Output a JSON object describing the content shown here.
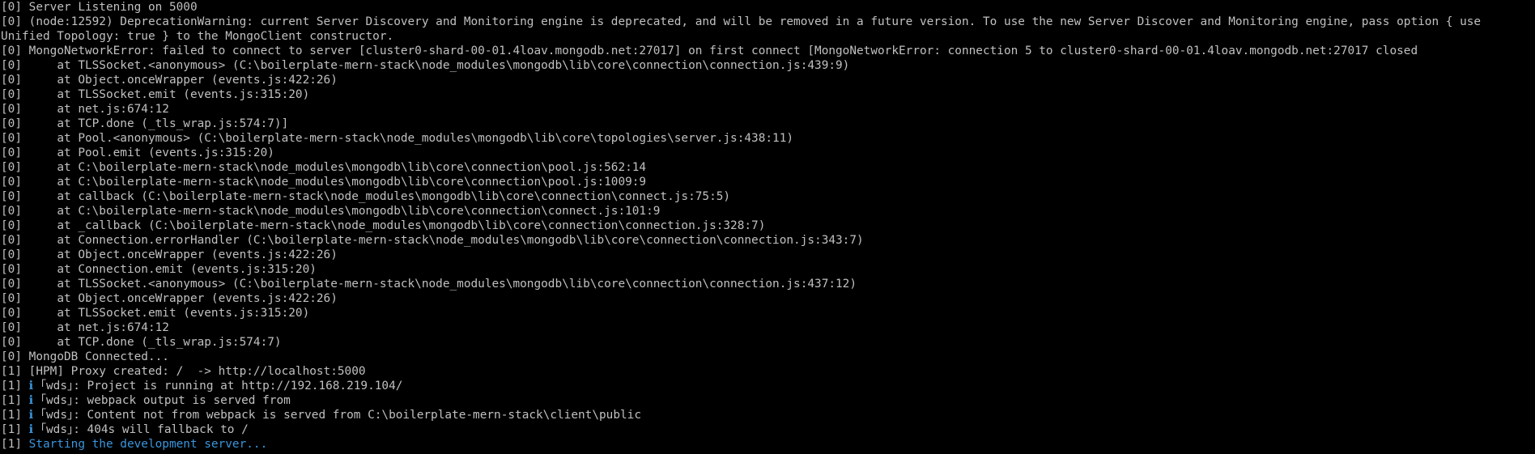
{
  "terminal": {
    "colors": {
      "background": "#000000",
      "foreground": "#c0c0c0",
      "accent": "#3a96dd"
    },
    "lines": [
      {
        "prefix": "[0]",
        "text": "Server Listening on 5000"
      },
      {
        "prefix": "[0]",
        "text": "(node:12592) DeprecationWarning: current Server Discovery and Monitoring engine is deprecated, and will be removed in a future version. To use the new Server Discover and Monitoring engine, pass option { use"
      },
      {
        "prefix": "",
        "text": "Unified Topology: true } to the MongoClient constructor."
      },
      {
        "prefix": "[0]",
        "text": "MongoNetworkError: failed to connect to server [cluster0-shard-00-01.4loav.mongodb.net:27017] on first connect [MongoNetworkError: connection 5 to cluster0-shard-00-01.4loav.mongodb.net:27017 closed"
      },
      {
        "prefix": "[0]",
        "text": "    at TLSSocket.<anonymous> (C:\\boilerplate-mern-stack\\node_modules\\mongodb\\lib\\core\\connection\\connection.js:439:9)"
      },
      {
        "prefix": "[0]",
        "text": "    at Object.onceWrapper (events.js:422:26)"
      },
      {
        "prefix": "[0]",
        "text": "    at TLSSocket.emit (events.js:315:20)"
      },
      {
        "prefix": "[0]",
        "text": "    at net.js:674:12"
      },
      {
        "prefix": "[0]",
        "text": "    at TCP.done (_tls_wrap.js:574:7)]"
      },
      {
        "prefix": "[0]",
        "text": "    at Pool.<anonymous> (C:\\boilerplate-mern-stack\\node_modules\\mongodb\\lib\\core\\topologies\\server.js:438:11)"
      },
      {
        "prefix": "[0]",
        "text": "    at Pool.emit (events.js:315:20)"
      },
      {
        "prefix": "[0]",
        "text": "    at C:\\boilerplate-mern-stack\\node_modules\\mongodb\\lib\\core\\connection\\pool.js:562:14"
      },
      {
        "prefix": "[0]",
        "text": "    at C:\\boilerplate-mern-stack\\node_modules\\mongodb\\lib\\core\\connection\\pool.js:1009:9"
      },
      {
        "prefix": "[0]",
        "text": "    at callback (C:\\boilerplate-mern-stack\\node_modules\\mongodb\\lib\\core\\connection\\connect.js:75:5)"
      },
      {
        "prefix": "[0]",
        "text": "    at C:\\boilerplate-mern-stack\\node_modules\\mongodb\\lib\\core\\connection\\connect.js:101:9"
      },
      {
        "prefix": "[0]",
        "text": "    at _callback (C:\\boilerplate-mern-stack\\node_modules\\mongodb\\lib\\core\\connection\\connection.js:328:7)"
      },
      {
        "prefix": "[0]",
        "text": "    at Connection.errorHandler (C:\\boilerplate-mern-stack\\node_modules\\mongodb\\lib\\core\\connection\\connection.js:343:7)"
      },
      {
        "prefix": "[0]",
        "text": "    at Object.onceWrapper (events.js:422:26)"
      },
      {
        "prefix": "[0]",
        "text": "    at Connection.emit (events.js:315:20)"
      },
      {
        "prefix": "[0]",
        "text": "    at TLSSocket.<anonymous> (C:\\boilerplate-mern-stack\\node_modules\\mongodb\\lib\\core\\connection\\connection.js:437:12)"
      },
      {
        "prefix": "[0]",
        "text": "    at Object.onceWrapper (events.js:422:26)"
      },
      {
        "prefix": "[0]",
        "text": "    at TLSSocket.emit (events.js:315:20)"
      },
      {
        "prefix": "[0]",
        "text": "    at net.js:674:12"
      },
      {
        "prefix": "[0]",
        "text": "    at TCP.done (_tls_wrap.js:574:7)"
      },
      {
        "prefix": "[0]",
        "text": "MongoDB Connected..."
      },
      {
        "prefix": "[1]",
        "text": "[HPM] Proxy created: /  -> http://localhost:5000"
      },
      {
        "prefix": "[1]",
        "wds": true,
        "text": "Project is running at http://192.168.219.104/"
      },
      {
        "prefix": "[1]",
        "wds": true,
        "text": "webpack output is served from"
      },
      {
        "prefix": "[1]",
        "wds": true,
        "text": "Content not from webpack is served from C:\\boilerplate-mern-stack\\client\\public"
      },
      {
        "prefix": "[1]",
        "wds": true,
        "text": "404s will fallback to /"
      },
      {
        "prefix": "[1]",
        "cyan": true,
        "text": "Starting the development server..."
      }
    ],
    "wds_tag": "｢wds｣:",
    "wds_bar": "ℹ"
  }
}
